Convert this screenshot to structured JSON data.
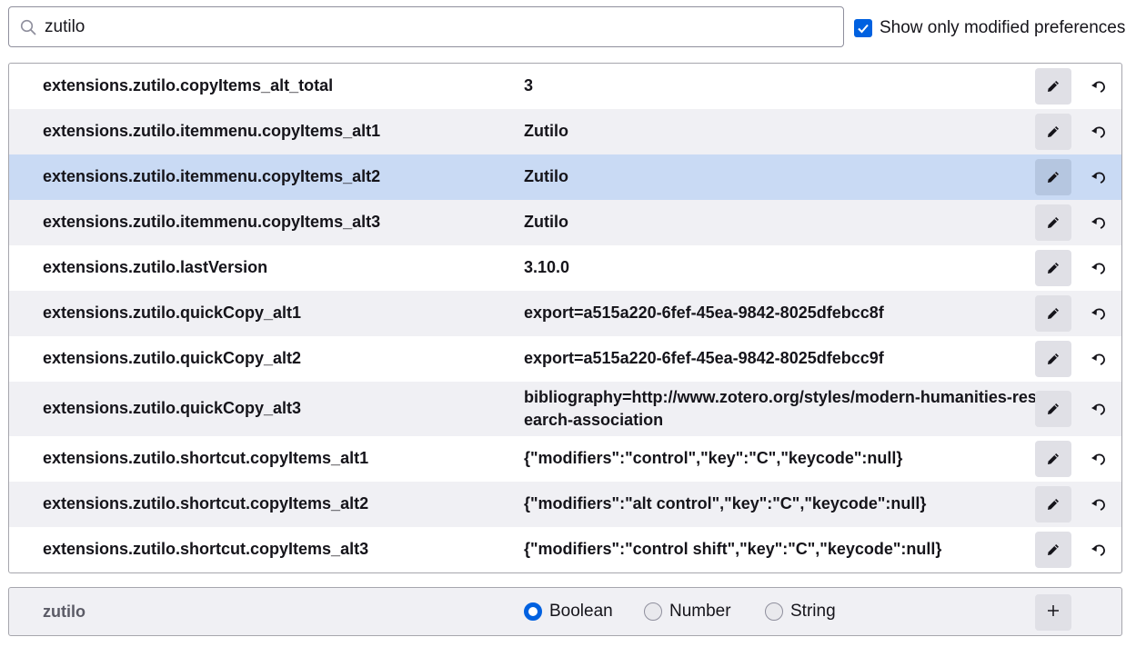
{
  "search": {
    "value": "zutilo",
    "icon": "search-icon"
  },
  "filter": {
    "show_modified_label": "Show only modified preferences",
    "checked": true
  },
  "preferences": [
    {
      "name": "extensions.zutilo.copyItems_alt_total",
      "value": "3"
    },
    {
      "name": "extensions.zutilo.itemmenu.copyItems_alt1",
      "value": "Zutilo"
    },
    {
      "name": "extensions.zutilo.itemmenu.copyItems_alt2",
      "value": "Zutilo",
      "selected": true
    },
    {
      "name": "extensions.zutilo.itemmenu.copyItems_alt3",
      "value": "Zutilo"
    },
    {
      "name": "extensions.zutilo.lastVersion",
      "value": "3.10.0"
    },
    {
      "name": "extensions.zutilo.quickCopy_alt1",
      "value": "export=a515a220-6fef-45ea-9842-8025dfebcc8f"
    },
    {
      "name": "extensions.zutilo.quickCopy_alt2",
      "value": "export=a515a220-6fef-45ea-9842-8025dfebcc9f"
    },
    {
      "name": "extensions.zutilo.quickCopy_alt3",
      "value": "bibliography=http://www.zotero.org/styles/modern-humanities-research-association"
    },
    {
      "name": "extensions.zutilo.shortcut.copyItems_alt1",
      "value": "{\"modifiers\":\"control\",\"key\":\"C\",\"keycode\":null}"
    },
    {
      "name": "extensions.zutilo.shortcut.copyItems_alt2",
      "value": "{\"modifiers\":\"alt control\",\"key\":\"C\",\"keycode\":null}"
    },
    {
      "name": "extensions.zutilo.shortcut.copyItems_alt3",
      "value": "{\"modifiers\":\"control shift\",\"key\":\"C\",\"keycode\":null}"
    }
  ],
  "new_pref": {
    "name": "zutilo",
    "types": [
      {
        "label": "Boolean",
        "checked": true
      },
      {
        "label": "Number",
        "checked": false
      },
      {
        "label": "String",
        "checked": false
      }
    ]
  },
  "icons": {
    "edit": "pencil-icon",
    "reset": "reset-icon",
    "add": "plus-icon"
  },
  "colors": {
    "accent": "#0061e0",
    "selected_row": "#c9daf4",
    "alt_row": "#f0f0f4"
  }
}
